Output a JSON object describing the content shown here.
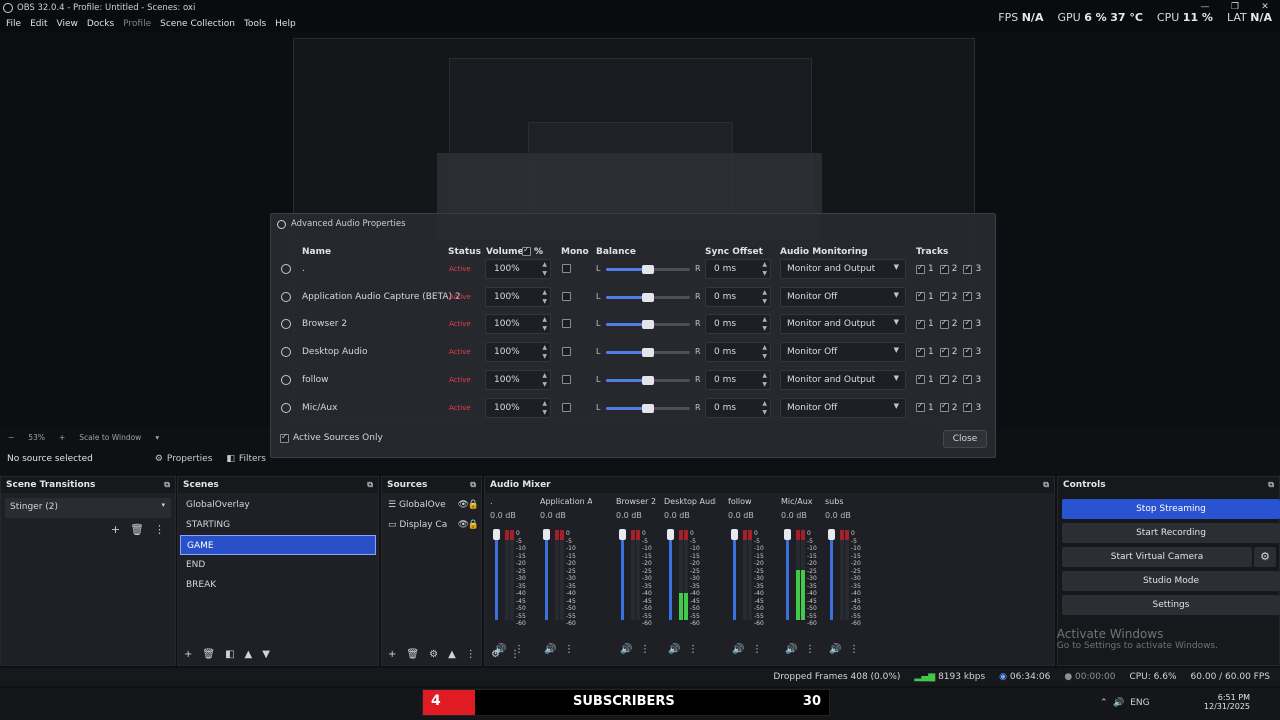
{
  "window": {
    "title": "OBS 32.0.4 - Profile: Untitled - Scenes: oxi"
  },
  "menu": [
    "File",
    "Edit",
    "View",
    "Docks",
    "Profile",
    "Scene Collection",
    "Tools",
    "Help"
  ],
  "stats": {
    "fps_label": "FPS",
    "fps": "N/A",
    "gpu_label": "GPU",
    "gpu": "6 %",
    "gpu_temp": "37 °C",
    "cpu_label": "CPU",
    "cpu": "11 %",
    "lat_label": "LAT",
    "lat": "N/A"
  },
  "zoom": {
    "value": "53%",
    "mode": "Scale to Window"
  },
  "dialog": {
    "title": "Advanced Audio Properties",
    "headers": {
      "name": "Name",
      "status": "Status",
      "volume": "Volume",
      "percent": "%",
      "mono": "Mono",
      "balance": "Balance",
      "sync": "Sync Offset",
      "monitoring": "Audio Monitoring",
      "tracks": "Tracks"
    },
    "rows": [
      {
        "name": ".",
        "status": "Active",
        "volume": "100%",
        "balance": "0.5",
        "sync": "0 ms",
        "monitoring": "Monitor and Output"
      },
      {
        "name": "Application Audio Capture (BETA) 2",
        "status": "Active",
        "volume": "100%",
        "balance": "0.5",
        "sync": "0 ms",
        "monitoring": "Monitor Off"
      },
      {
        "name": "Browser 2",
        "status": "Active",
        "volume": "100%",
        "balance": "0.5",
        "sync": "0 ms",
        "monitoring": "Monitor and Output"
      },
      {
        "name": "Desktop Audio",
        "status": "Active",
        "volume": "100%",
        "balance": "0.5",
        "sync": "0 ms",
        "monitoring": "Monitor Off"
      },
      {
        "name": "follow",
        "status": "Active",
        "volume": "100%",
        "balance": "0.5",
        "sync": "0 ms",
        "monitoring": "Monitor and Output"
      },
      {
        "name": "Mic/Aux",
        "status": "Active",
        "volume": "100%",
        "balance": "0.5",
        "sync": "0 ms",
        "monitoring": "Monitor Off"
      }
    ],
    "track_labels": [
      "1",
      "2",
      "3"
    ],
    "active_only_label": "Active Sources Only",
    "close_label": "Close"
  },
  "source_bar": {
    "selected": "No source selected",
    "properties": "Properties",
    "filters": "Filters"
  },
  "transitions": {
    "title": "Scene Transitions",
    "selected": "Stinger (2)"
  },
  "scenes": {
    "title": "Scenes",
    "items": [
      "GlobalOverlay",
      "STARTING",
      "GAME",
      "END",
      "BREAK"
    ],
    "selected": "GAME"
  },
  "sources": {
    "title": "Sources",
    "items": [
      "GlobalOve",
      "Display Ca"
    ]
  },
  "mixer": {
    "title": "Audio Mixer",
    "channels": [
      {
        "name": ".",
        "db": "0.0 dB",
        "level": 0.0
      },
      {
        "name": "Application Audio C",
        "db": "0.0 dB",
        "level": 0.0
      },
      {
        "name": "Browser 2",
        "db": "0.0 dB",
        "level": 0.0
      },
      {
        "name": "Desktop Audio",
        "db": "0.0 dB",
        "level": 0.3
      },
      {
        "name": "follow",
        "db": "0.0 dB",
        "level": 0.0
      },
      {
        "name": "Mic/Aux",
        "db": "0.0 dB",
        "level": 0.55
      },
      {
        "name": "subs",
        "db": "0.0 dB",
        "level": 0.0
      }
    ],
    "scale": [
      "0",
      "-5",
      "-10",
      "-15",
      "-20",
      "-25",
      "-30",
      "-35",
      "-40",
      "-45",
      "-50",
      "-55",
      "-60"
    ]
  },
  "controls": {
    "title": "Controls",
    "buttons": [
      "Stop Streaming",
      "Start Recording",
      "Start Virtual Camera",
      "Studio Mode",
      "Settings"
    ]
  },
  "watermark": {
    "line1": "Activate Windows",
    "line2": "Go to Settings to activate Windows."
  },
  "status": {
    "dropped": "Dropped Frames 408 (0.0%)",
    "kbps": "8193 kbps",
    "stream_time": "06:34:06",
    "rec_time": "00:00:00",
    "cpu": "CPU: 6.6%",
    "fps": "60.00 / 60.00 FPS"
  },
  "taskbar": {
    "time": "6:51 PM",
    "date": "12/31/2025",
    "lang": "ENG",
    "subs_left": "4",
    "subs_text": "SUBSCRIBERS",
    "subs_right": "30"
  }
}
